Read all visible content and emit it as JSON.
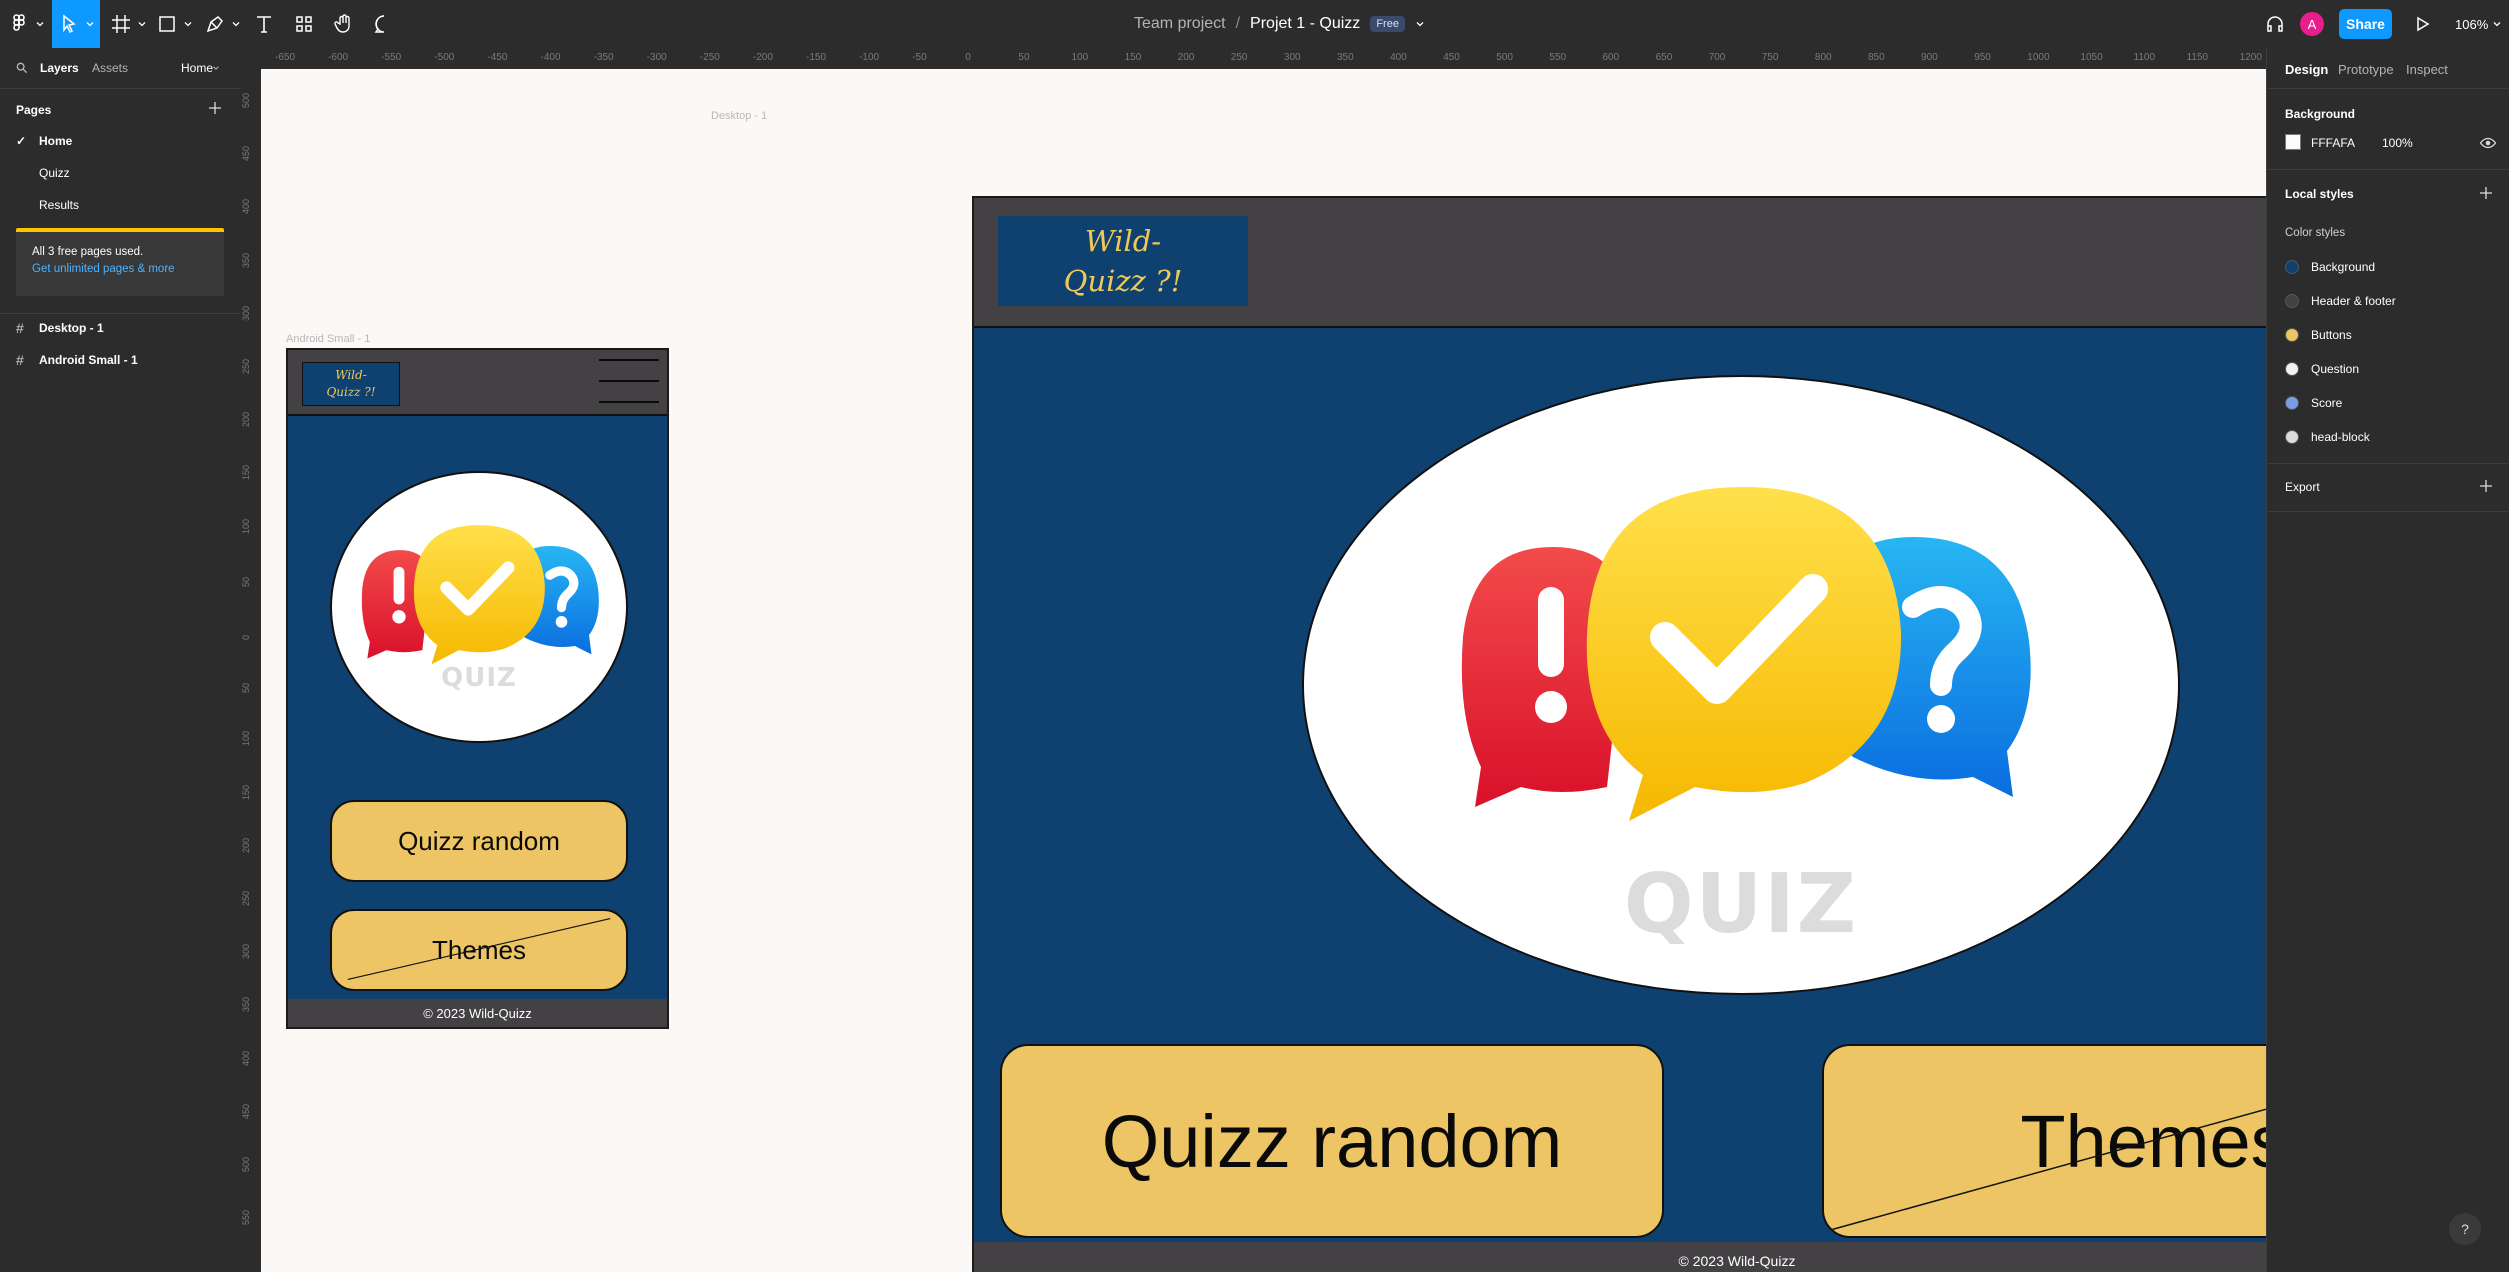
{
  "toolbar": {
    "breadcrumb_team": "Team project",
    "breadcrumb_sep": "/",
    "project_name": "Projet 1 - Quizz",
    "plan_badge": "Free",
    "avatar_initial": "A",
    "share_label": "Share",
    "zoom_label": "106%"
  },
  "left_panel": {
    "tab_layers": "Layers",
    "tab_assets": "Assets",
    "page_selector": "Home",
    "pages_heading": "Pages",
    "pages": [
      {
        "label": "Home",
        "checkmark": "✓"
      },
      {
        "label": "Quizz"
      },
      {
        "label": "Results"
      }
    ],
    "banner_text": "All 3 free pages used.",
    "banner_link": "Get unlimited pages & more",
    "layers": [
      {
        "label": "Desktop - 1"
      },
      {
        "label": "Android Small - 1"
      }
    ]
  },
  "right_panel": {
    "tabs": [
      "Design",
      "Prototype",
      "Inspect"
    ],
    "background_heading": "Background",
    "background_hex": "FFFAFA",
    "background_opacity": "100%",
    "local_styles_heading": "Local styles",
    "color_styles_heading": "Color styles",
    "color_styles": [
      {
        "label": "Background",
        "color": "#0f4170"
      },
      {
        "label": "Header & footer",
        "color": "#444144"
      },
      {
        "label": "Buttons",
        "color": "#edc565"
      },
      {
        "label": "Question",
        "color": "#f2f2f2"
      },
      {
        "label": "Score",
        "color": "#7b9ce6"
      },
      {
        "label": "head-block",
        "color": "#dcdcdc"
      }
    ],
    "export_heading": "Export"
  },
  "rulers": {
    "top": [
      "-650",
      "-600",
      "-550",
      "-500",
      "-450",
      "-400",
      "-350",
      "-300",
      "-250",
      "-200",
      "-150",
      "-100",
      "-50",
      "0",
      "50",
      "100",
      "150",
      "200",
      "250",
      "300",
      "350",
      "400",
      "450",
      "500",
      "550",
      "600",
      "650",
      "700",
      "750",
      "800",
      "850",
      "900",
      "950",
      "1000",
      "1050",
      "1100",
      "1150",
      "1200"
    ],
    "left": [
      "500",
      "450",
      "400",
      "350",
      "300",
      "250",
      "200",
      "150",
      "100",
      "50",
      "0",
      "50",
      "100",
      "150",
      "200",
      "250",
      "300",
      "350",
      "400",
      "450",
      "500",
      "550"
    ]
  },
  "canvas": {
    "desktop_frame_label": "Desktop - 1",
    "android_frame_label": "Android Small - 1",
    "site": {
      "logo_line1": "Wild-",
      "logo_line2": "Quizz ?!",
      "hero_caption": "QUIZ",
      "button_random": "Quizz random",
      "button_themes": "Themes",
      "footer": "© 2023  Wild-Quizz"
    }
  },
  "colors": {
    "accent": "#0d99ff",
    "site_background": "#0f4170",
    "site_header": "#444144",
    "site_button": "#edc565",
    "logo_text": "#f0c859"
  }
}
